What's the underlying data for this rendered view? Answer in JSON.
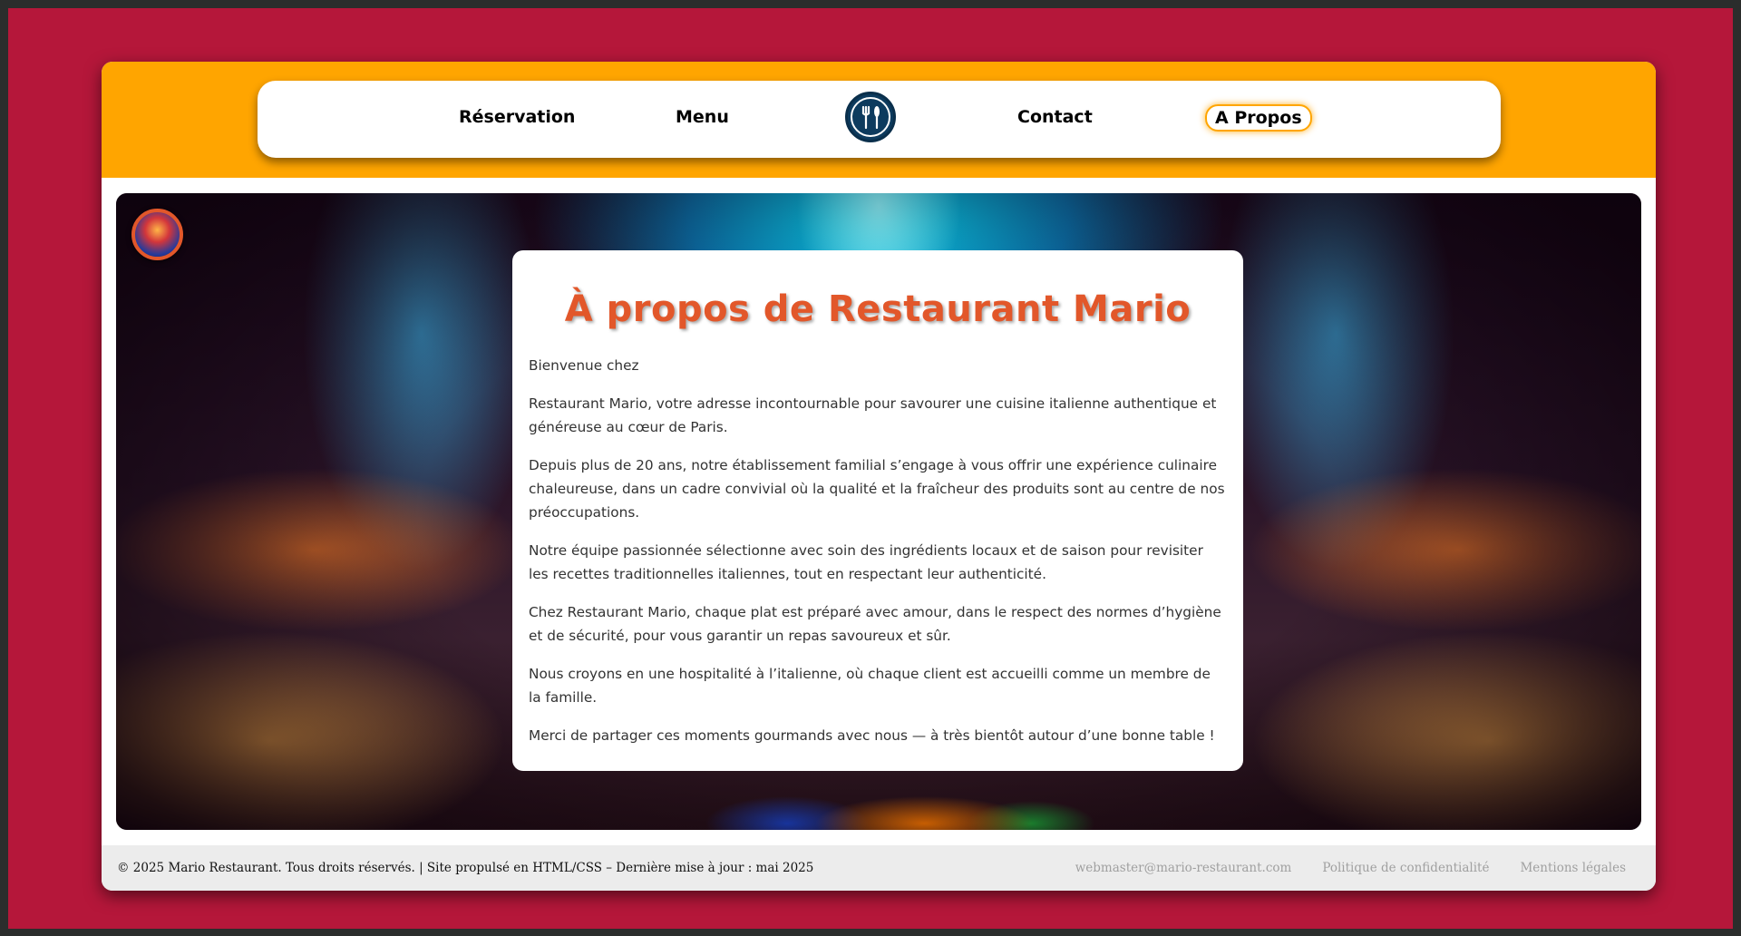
{
  "nav": {
    "reservation": "Réservation",
    "menu": "Menu",
    "contact": "Contact",
    "about": "A Propos",
    "logo_icon": "cutlery-icon"
  },
  "colors": {
    "page_background": "#b5173a",
    "header_background": "#ffa500",
    "title_color": "#e2572a",
    "logo_color": "#0d3b5e"
  },
  "about": {
    "title": "À propos de Restaurant Mario",
    "paragraphs": [
      "Bienvenue chez",
      "Restaurant Mario, votre adresse incontournable pour savourer une cuisine italienne authentique et généreuse au cœur de Paris.",
      "Depuis plus de 20 ans, notre établissement familial s’engage à vous offrir une expérience culinaire chaleureuse, dans un cadre convivial où la qualité et la fraîcheur des produits sont au centre de nos préoccupations.",
      "Notre équipe passionnée sélectionne avec soin des ingrédients locaux et de saison pour revisiter les recettes traditionnelles italiennes, tout en respectant leur authenticité.",
      "Chez Restaurant Mario, chaque plat est préparé avec amour, dans le respect des normes d’hygiène et de sécurité, pour vous garantir un repas savoureux et sûr.",
      "Nous croyons en une hospitalité à l’italienne, où chaque client est accueilli comme un membre de la famille.",
      "Merci de partager ces moments gourmands avec nous — à très bientôt autour d’une bonne table !"
    ]
  },
  "footer": {
    "copyright": "© 2025 Mario Restaurant. Tous droits réservés. | Site propulsé en HTML/CSS – Dernière mise à jour : mai 2025",
    "email": "webmaster@mario-restaurant.com",
    "privacy": "Politique de confidentialité",
    "legal": "Mentions légales"
  }
}
